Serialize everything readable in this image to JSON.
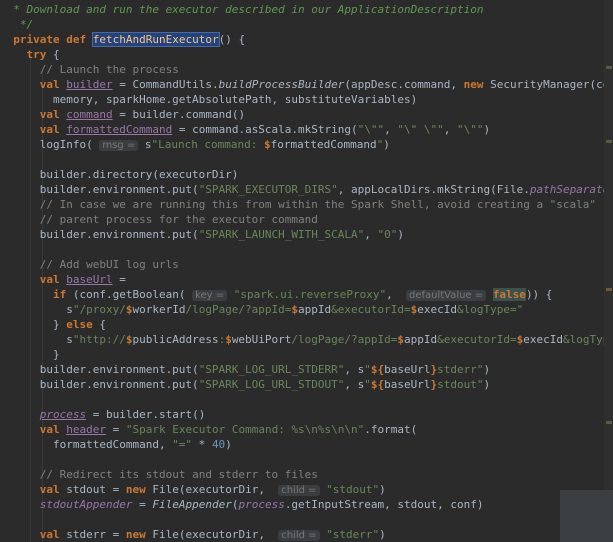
{
  "editor": {
    "lines": [
      [
        {
          "t": "  * Download and run the executor described in our ApplicationDescription",
          "c": "doc"
        }
      ],
      [
        {
          "t": "   */",
          "c": "doc"
        }
      ],
      [
        {
          "t": "  "
        },
        {
          "t": "private def ",
          "c": "kw"
        },
        {
          "t": "fetchAndRunExecutor",
          "c": "fn sel"
        },
        {
          "t": "() {"
        }
      ],
      [
        {
          "t": "    "
        },
        {
          "t": "try ",
          "c": "kw"
        },
        {
          "t": "{"
        }
      ],
      [
        {
          "t": "      "
        },
        {
          "t": "// Launch the process",
          "c": "cm"
        }
      ],
      [
        {
          "t": "      "
        },
        {
          "t": "val ",
          "c": "kw"
        },
        {
          "t": "builder",
          "c": "fld ul"
        },
        {
          "t": " = CommandUtils."
        },
        {
          "t": "buildProcessBuilder",
          "c": "it"
        },
        {
          "t": "(appDesc.command, "
        },
        {
          "t": "new ",
          "c": "kw"
        },
        {
          "t": "SecurityManager(conf),"
        }
      ],
      [
        {
          "t": "        memory, sparkHome.getAbsolutePath, substituteVariables)"
        }
      ],
      [
        {
          "t": "      "
        },
        {
          "t": "val ",
          "c": "kw"
        },
        {
          "t": "command",
          "c": "fld ul"
        },
        {
          "t": " = builder.command()"
        }
      ],
      [
        {
          "t": "      "
        },
        {
          "t": "val ",
          "c": "kw"
        },
        {
          "t": "formattedCommand",
          "c": "fld ul"
        },
        {
          "t": " = command.asScala.mkString("
        },
        {
          "t": "\"\\\"\"",
          "c": "str"
        },
        {
          "t": ", "
        },
        {
          "t": "\"\\\" \\\"\"",
          "c": "str"
        },
        {
          "t": ", "
        },
        {
          "t": "\"\\\"\"",
          "c": "str"
        },
        {
          "t": ")"
        }
      ],
      [
        {
          "t": "      logInfo( "
        },
        {
          "t": "msg =",
          "c": "hintlbl"
        },
        {
          "t": " s"
        },
        {
          "t": "\"Launch command: ",
          "c": "str"
        },
        {
          "t": "$",
          "c": "kw"
        },
        {
          "t": "formattedCommand"
        },
        {
          "t": "\"",
          "c": "str"
        },
        {
          "t": ")"
        }
      ],
      [
        {
          "t": ""
        }
      ],
      [
        {
          "t": "      builder.directory(executorDir)"
        }
      ],
      [
        {
          "t": "      builder.environment.put("
        },
        {
          "t": "\"SPARK_EXECUTOR_DIRS\"",
          "c": "str"
        },
        {
          "t": ", appLocalDirs.mkString(File."
        },
        {
          "t": "pathSeparator",
          "c": "fld it"
        },
        {
          "t": "))"
        }
      ],
      [
        {
          "t": "      "
        },
        {
          "t": "// In case we are running this from within the Spark Shell, avoid creating a \"scala\"",
          "c": "cm"
        }
      ],
      [
        {
          "t": "      "
        },
        {
          "t": "// parent process for the executor command",
          "c": "cm"
        }
      ],
      [
        {
          "t": "      builder.environment.put("
        },
        {
          "t": "\"SPARK_LAUNCH_WITH_SCALA\"",
          "c": "str"
        },
        {
          "t": ", "
        },
        {
          "t": "\"0\"",
          "c": "str"
        },
        {
          "t": ")"
        }
      ],
      [
        {
          "t": ""
        }
      ],
      [
        {
          "t": "      "
        },
        {
          "t": "// Add webUI log urls",
          "c": "cm"
        }
      ],
      [
        {
          "t": "      "
        },
        {
          "t": "val ",
          "c": "kw"
        },
        {
          "t": "baseUrl",
          "c": "fld ul"
        },
        {
          "t": " ="
        }
      ],
      [
        {
          "t": "        "
        },
        {
          "t": "if ",
          "c": "kw"
        },
        {
          "t": "(conf.getBoolean( "
        },
        {
          "t": "key =",
          "c": "hintlbl"
        },
        {
          "t": " "
        },
        {
          "t": "\"spark.ui.reverseProxy\"",
          "c": "str"
        },
        {
          "t": ",  "
        },
        {
          "t": "defaultValue =",
          "c": "hintlbl"
        },
        {
          "t": " "
        },
        {
          "t": "false",
          "c": "hlbg"
        },
        {
          "t": ")) {"
        }
      ],
      [
        {
          "t": "          s"
        },
        {
          "t": "\"/proxy/",
          "c": "str"
        },
        {
          "t": "$",
          "c": "kw"
        },
        {
          "t": "workerId"
        },
        {
          "t": "/logPage/?appId=",
          "c": "str"
        },
        {
          "t": "$",
          "c": "kw"
        },
        {
          "t": "appId"
        },
        {
          "t": "&executorId=",
          "c": "str"
        },
        {
          "t": "$",
          "c": "kw"
        },
        {
          "t": "execId"
        },
        {
          "t": "&logType=\"",
          "c": "str"
        }
      ],
      [
        {
          "t": "        } "
        },
        {
          "t": "else ",
          "c": "kw"
        },
        {
          "t": "{"
        }
      ],
      [
        {
          "t": "          s"
        },
        {
          "t": "\"http://",
          "c": "str"
        },
        {
          "t": "$",
          "c": "kw"
        },
        {
          "t": "publicAddress"
        },
        {
          "t": ":",
          "c": "str"
        },
        {
          "t": "$",
          "c": "kw"
        },
        {
          "t": "webUiPort"
        },
        {
          "t": "/logPage/?appId=",
          "c": "str"
        },
        {
          "t": "$",
          "c": "kw"
        },
        {
          "t": "appId"
        },
        {
          "t": "&executorId=",
          "c": "str"
        },
        {
          "t": "$",
          "c": "kw"
        },
        {
          "t": "execId"
        },
        {
          "t": "&logType=\"",
          "c": "str"
        }
      ],
      [
        {
          "t": "        }"
        }
      ],
      [
        {
          "t": "      builder.environment.put("
        },
        {
          "t": "\"SPARK_LOG_URL_STDERR\"",
          "c": "str"
        },
        {
          "t": ", s"
        },
        {
          "t": "\"",
          "c": "str"
        },
        {
          "t": "${",
          "c": "kw"
        },
        {
          "t": "baseUrl"
        },
        {
          "t": "}",
          "c": "kw"
        },
        {
          "t": "stderr\"",
          "c": "str"
        },
        {
          "t": ")"
        }
      ],
      [
        {
          "t": "      builder.environment.put("
        },
        {
          "t": "\"SPARK_LOG_URL_STDOUT\"",
          "c": "str"
        },
        {
          "t": ", s"
        },
        {
          "t": "\"",
          "c": "str"
        },
        {
          "t": "${",
          "c": "kw"
        },
        {
          "t": "baseUrl"
        },
        {
          "t": "}",
          "c": "kw"
        },
        {
          "t": "stdout\"",
          "c": "str"
        },
        {
          "t": ")"
        }
      ],
      [
        {
          "t": ""
        }
      ],
      [
        {
          "t": "      "
        },
        {
          "t": "process",
          "c": "fld it ul"
        },
        {
          "t": " = builder.start()"
        }
      ],
      [
        {
          "t": "      "
        },
        {
          "t": "val ",
          "c": "kw"
        },
        {
          "t": "header",
          "c": "fld ul"
        },
        {
          "t": " = "
        },
        {
          "t": "\"Spark Executor Command: %s\\n%s\\n\\n\"",
          "c": "str"
        },
        {
          "t": ".format("
        }
      ],
      [
        {
          "t": "        formattedCommand, "
        },
        {
          "t": "\"=\"",
          "c": "str"
        },
        {
          "t": " * "
        },
        {
          "t": "40",
          "c": "num"
        },
        {
          "t": ")"
        }
      ],
      [
        {
          "t": ""
        }
      ],
      [
        {
          "t": "      "
        },
        {
          "t": "// Redirect its stdout and stderr to files",
          "c": "cm"
        }
      ],
      [
        {
          "t": "      "
        },
        {
          "t": "val ",
          "c": "kw"
        },
        {
          "t": "stdout = "
        },
        {
          "t": "new ",
          "c": "kw"
        },
        {
          "t": "File(executorDir,  "
        },
        {
          "t": "child =",
          "c": "hintlbl"
        },
        {
          "t": " "
        },
        {
          "t": "\"stdout\"",
          "c": "str"
        },
        {
          "t": ")"
        }
      ],
      [
        {
          "t": "      "
        },
        {
          "t": "stdoutAppender",
          "c": "fld it"
        },
        {
          "t": " = "
        },
        {
          "t": "FileAppender",
          "c": "it"
        },
        {
          "t": "("
        },
        {
          "t": "process",
          "c": "fld it"
        },
        {
          "t": ".getInputStream, stdout, conf)"
        }
      ],
      [
        {
          "t": ""
        }
      ],
      [
        {
          "t": "      "
        },
        {
          "t": "val ",
          "c": "kw"
        },
        {
          "t": "stderr = "
        },
        {
          "t": "new ",
          "c": "kw"
        },
        {
          "t": "File(executorDir,  "
        },
        {
          "t": "child =",
          "c": "hintlbl"
        },
        {
          "t": " "
        },
        {
          "t": "\"stderr\"",
          "c": "str"
        },
        {
          "t": ")"
        }
      ]
    ]
  },
  "colors": {
    "background": "#2b2b2b",
    "keyword": "#cc7832",
    "string": "#6a8759",
    "comment": "#808080",
    "doc_comment": "#629755",
    "field": "#9876aa",
    "method_decl": "#ffc66d",
    "number": "#6897bb"
  }
}
